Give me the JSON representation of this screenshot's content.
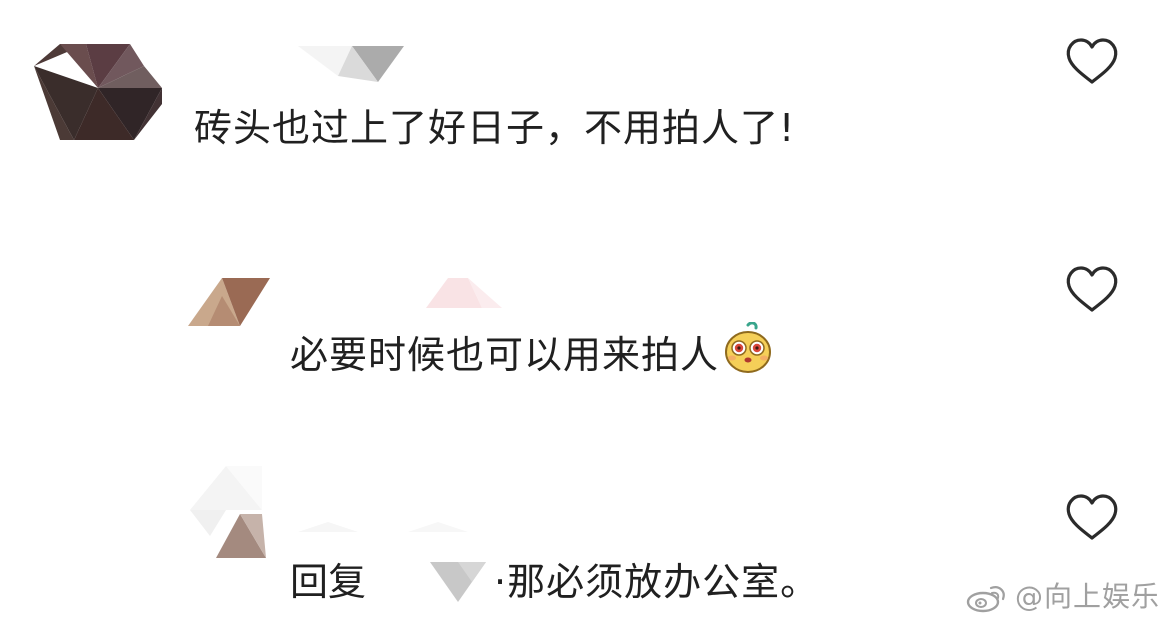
{
  "comments": [
    {
      "text": "砖头也过上了好日子，不用拍人了!",
      "like_icon": "heart-outline-icon"
    },
    {
      "text": "必要时候也可以用来拍人",
      "emoji": "yellow-bun-emoji-icon",
      "like_icon": "heart-outline-icon"
    },
    {
      "reply_prefix": "回复",
      "text": "·那必须放办公室。",
      "like_icon": "heart-outline-icon"
    }
  ],
  "watermark": {
    "text": "@向上娱乐",
    "icon": "weibo-logo-icon"
  },
  "colors": {
    "text": "#202020",
    "icon": "#2b2b2b",
    "watermark": "#a0a0a0"
  }
}
